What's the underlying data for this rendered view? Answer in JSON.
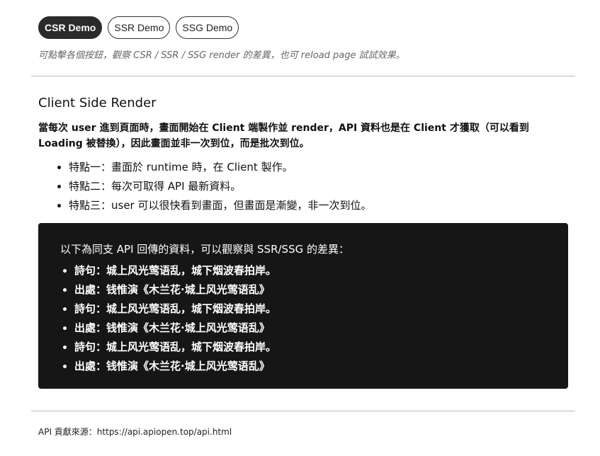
{
  "nav": {
    "buttons": [
      {
        "label": "CSR Demo",
        "active": true
      },
      {
        "label": "SSR Demo",
        "active": false
      },
      {
        "label": "SSG Demo",
        "active": false
      }
    ],
    "hint": "可點擊各個按鈕，觀察 CSR / SSR / SSG render 的差異，也可 reload page 試試效果。"
  },
  "section": {
    "title": "Client Side Render",
    "description": "當每次 user 進到頁面時，畫面開始在 Client 端製作並 render，API 資料也是在 Client 才獲取（可以看到 Loading 被替換），因此畫面並非一次到位，而是批次到位。",
    "features": [
      "特點一：畫面於 runtime 時，在 Client 製作。",
      "特點二：每次可取得 API 最新資料。",
      "特點三：user 可以很快看到畫面，但畫面是漸變，非一次到位。"
    ]
  },
  "panel": {
    "title": "以下為同支 API 回傳的資料，可以觀察與 SSR/SSG 的差異：",
    "items": [
      "詩句：城上风光莺语乱，城下烟波春拍岸。",
      "出處：钱惟演《木兰花·城上风光莺语乱》",
      "詩句：城上风光莺语乱，城下烟波春拍岸。",
      "出處：钱惟演《木兰花·城上风光莺语乱》",
      "詩句：城上风光莺语乱，城下烟波春拍岸。",
      "出處：钱惟演《木兰花·城上风光莺语乱》"
    ]
  },
  "footer": {
    "source": "API 貢獻來源：https://api.apiopen.top/api.html"
  },
  "colors": {
    "active_button_bg": "#2b2b2b",
    "panel_bg": "#161616",
    "divider": "#bdbdbd",
    "hint_text": "#666666"
  }
}
